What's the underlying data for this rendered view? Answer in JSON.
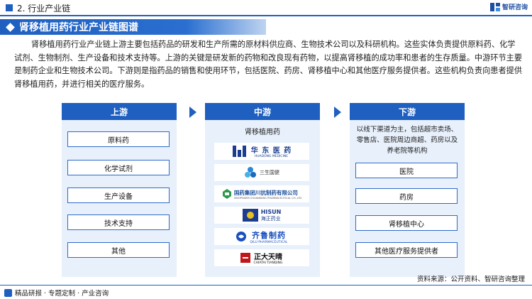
{
  "header": {
    "section_title": "2. 行业产业链",
    "brand_name": "智研咨询"
  },
  "banner": {
    "title": "肾移植用药行业产业链图谱"
  },
  "intro": "肾移植用药行业产业链上游主要包括药品的研发和生产所需的原材料供应商、生物技术公司以及科研机构。这些实体负责提供原料药、化学试剂、生物制剂、生产设备和技术支持等。上游的关键是研发新的药物和改良现有药物，以提高肾移植的成功率和患者的生存质量。中游环节主要是制药企业和生物技术公司。下游则是指药品的销售和使用环节，包括医院、药房、肾移植中心和其他医疗服务提供者。这些机构负责向患者提供肾移植用药，并进行相关的医疗服务。",
  "upstream": {
    "title": "上游",
    "items": [
      "原料药",
      "化学试剂",
      "生产设备",
      "技术支持",
      "其他"
    ]
  },
  "midstream": {
    "title": "中游",
    "label": "肾移植用药",
    "logos": [
      {
        "name": "华 东 医 药",
        "sub": "HUADONG MEDICINE",
        "color": "#1a3d8f"
      },
      {
        "name": "三生国健",
        "sub": "",
        "color": "#2a8ad8"
      },
      {
        "name": "国药集团川抗制药有限公司",
        "sub": "SINOPHARM CHUANKANG PHARMACEUTICAL CO.,LTD",
        "color": "#1a4f9c"
      },
      {
        "name": "HISUN",
        "sub": "海正药业",
        "color": "#1a3d8f"
      },
      {
        "name": "齐鲁制药",
        "sub": "QILU PHARMACEUTICAL",
        "color": "#1a4fbf"
      },
      {
        "name": "正大天晴",
        "sub": "CHIATAI TIANQING",
        "color": "#c0151a"
      }
    ]
  },
  "downstream": {
    "title": "下游",
    "description": "以线下渠道为主，包括超市卖场、零售店、医院周边商超、药房以及养老院等机构",
    "items": [
      "医院",
      "药房",
      "肾移植中心",
      "其他医疗服务提供者"
    ]
  },
  "footer": {
    "tagline": "精品研报 · 专题定制 · 产业咨询",
    "source": "资料来源：公开资料、智研咨询整理"
  },
  "colors": {
    "primary": "#1f5fbf",
    "panel": "#e8f0fb"
  }
}
